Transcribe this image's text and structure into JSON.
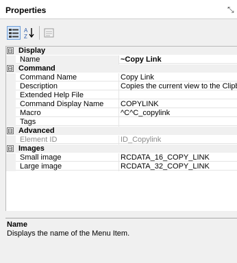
{
  "panel": {
    "title": "Properties",
    "pin_glyph": "⤡"
  },
  "toolbar": {
    "categorized_icon": "categorized-view-icon",
    "alpha_label": "A↓",
    "alpha_icon": "alphabetical-sort-icon",
    "pages_icon": "property-pages-icon"
  },
  "categories": [
    {
      "label": "Display",
      "toggle": "⊟"
    },
    {
      "label": "Command",
      "toggle": "⊟"
    },
    {
      "label": "Advanced",
      "toggle": "⊟"
    },
    {
      "label": "Images",
      "toggle": "⊟"
    }
  ],
  "properties": {
    "display": [
      {
        "name": "Name",
        "value": "~Copy Link"
      }
    ],
    "command": [
      {
        "name": "Command Name",
        "value": "Copy Link"
      },
      {
        "name": "Description",
        "value": "Copies the current view to the Clipb"
      },
      {
        "name": "Extended Help File",
        "value": ""
      },
      {
        "name": "Command Display Name",
        "value": "COPYLINK"
      },
      {
        "name": "Macro",
        "value": "^C^C_copylink"
      },
      {
        "name": "Tags",
        "value": ""
      }
    ],
    "advanced": [
      {
        "name": "Element ID",
        "value": "ID_Copylink"
      }
    ],
    "images": [
      {
        "name": "Small image",
        "value": "RCDATA_16_COPY_LINK"
      },
      {
        "name": "Large image",
        "value": "RCDATA_32_COPY_LINK"
      }
    ]
  },
  "description": {
    "title": "Name",
    "text": "Displays the name of the Menu Item."
  }
}
